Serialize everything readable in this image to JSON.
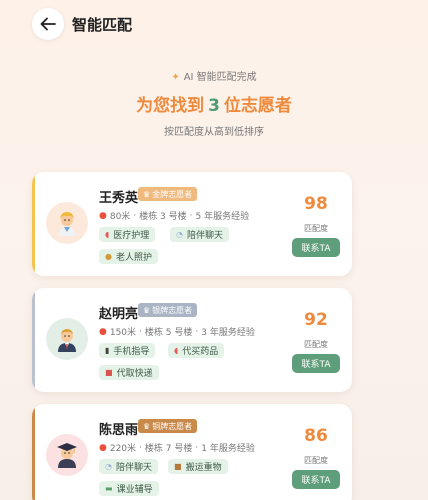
{
  "header": {
    "title": "智能匹配"
  },
  "summary": {
    "ai_status": "AI 智能匹配完成",
    "title_prefix": "为您找到",
    "count": "3",
    "title_suffix": "位志愿者",
    "sort_note": "按匹配度从高到低排序"
  },
  "colors": {
    "accent_orange": "#ef8a3c",
    "accent_green": "#5f9e7a",
    "gold": "#f0b97e",
    "silver": "#a9b4c4",
    "bronze": "#c98949"
  },
  "volunteers": [
    {
      "name": "王秀英",
      "badge": "金牌志愿者",
      "badge_icon": "medal-icon",
      "distance": "80米",
      "building": "楼栋 3 号楼",
      "experience": "5 年服务经验",
      "tags": [
        {
          "icon": "pill-icon",
          "label": "医疗护理"
        },
        {
          "icon": "chat-bubble-icon",
          "label": "陪伴聊天"
        },
        {
          "icon": "elder-icon",
          "label": "老人照护"
        }
      ],
      "score": "98",
      "score_label": "匹配度",
      "contact": "联系TA"
    },
    {
      "name": "赵明亮",
      "badge": "银牌志愿者",
      "badge_icon": "medal-icon",
      "distance": "150米",
      "building": "楼栋 5 号楼",
      "experience": "3 年服务经验",
      "tags": [
        {
          "icon": "phone-icon",
          "label": "手机指导"
        },
        {
          "icon": "pill-icon",
          "label": "代买药品"
        },
        {
          "icon": "package-icon",
          "label": "代取快递"
        }
      ],
      "score": "92",
      "score_label": "匹配度",
      "contact": "联系TA"
    },
    {
      "name": "陈思雨",
      "badge": "铜牌志愿者",
      "badge_icon": "medal-icon",
      "distance": "220米",
      "building": "楼栋 7 号楼",
      "experience": "1 年服务经验",
      "tags": [
        {
          "icon": "chat-bubble-icon",
          "label": "陪伴聊天"
        },
        {
          "icon": "box-icon",
          "label": "搬运重物"
        },
        {
          "icon": "book-icon",
          "label": "课业辅导"
        }
      ],
      "score": "86",
      "score_label": "匹配度",
      "contact": "联系TA"
    }
  ]
}
